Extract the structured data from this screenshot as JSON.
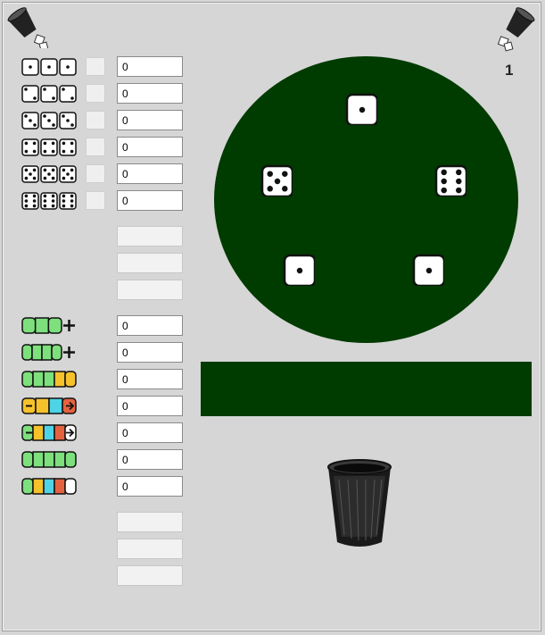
{
  "round": "1",
  "top_icons": {
    "left": "dice-cup-icon",
    "right": "dice-cup-icon"
  },
  "upper_section": [
    {
      "icon": "ones-icon",
      "face": 1,
      "value": "0"
    },
    {
      "icon": "twos-icon",
      "face": 2,
      "value": "0"
    },
    {
      "icon": "threes-icon",
      "face": 3,
      "value": "0"
    },
    {
      "icon": "fours-icon",
      "face": 4,
      "value": "0"
    },
    {
      "icon": "fives-icon",
      "face": 5,
      "value": "0"
    },
    {
      "icon": "sixes-icon",
      "face": 6,
      "value": "0"
    }
  ],
  "upper_totals": [
    "",
    "",
    ""
  ],
  "lower_section": [
    {
      "icon": "three-of-a-kind-icon",
      "value": "0"
    },
    {
      "icon": "four-of-a-kind-icon",
      "value": "0"
    },
    {
      "icon": "full-house-icon",
      "value": "0"
    },
    {
      "icon": "small-straight-icon",
      "value": "0"
    },
    {
      "icon": "large-straight-icon",
      "value": "0"
    },
    {
      "icon": "yahtzee-icon",
      "value": "0"
    },
    {
      "icon": "chance-icon",
      "value": "0"
    }
  ],
  "lower_totals": [
    "",
    "",
    ""
  ],
  "table_dice": [
    1,
    5,
    6,
    1,
    1
  ],
  "colors": {
    "table": "#003b00",
    "background": "#d6d6d6",
    "green": "#7de07d",
    "yellow": "#f6c22b",
    "cyan": "#4fd3e6",
    "red": "#e5623e"
  }
}
